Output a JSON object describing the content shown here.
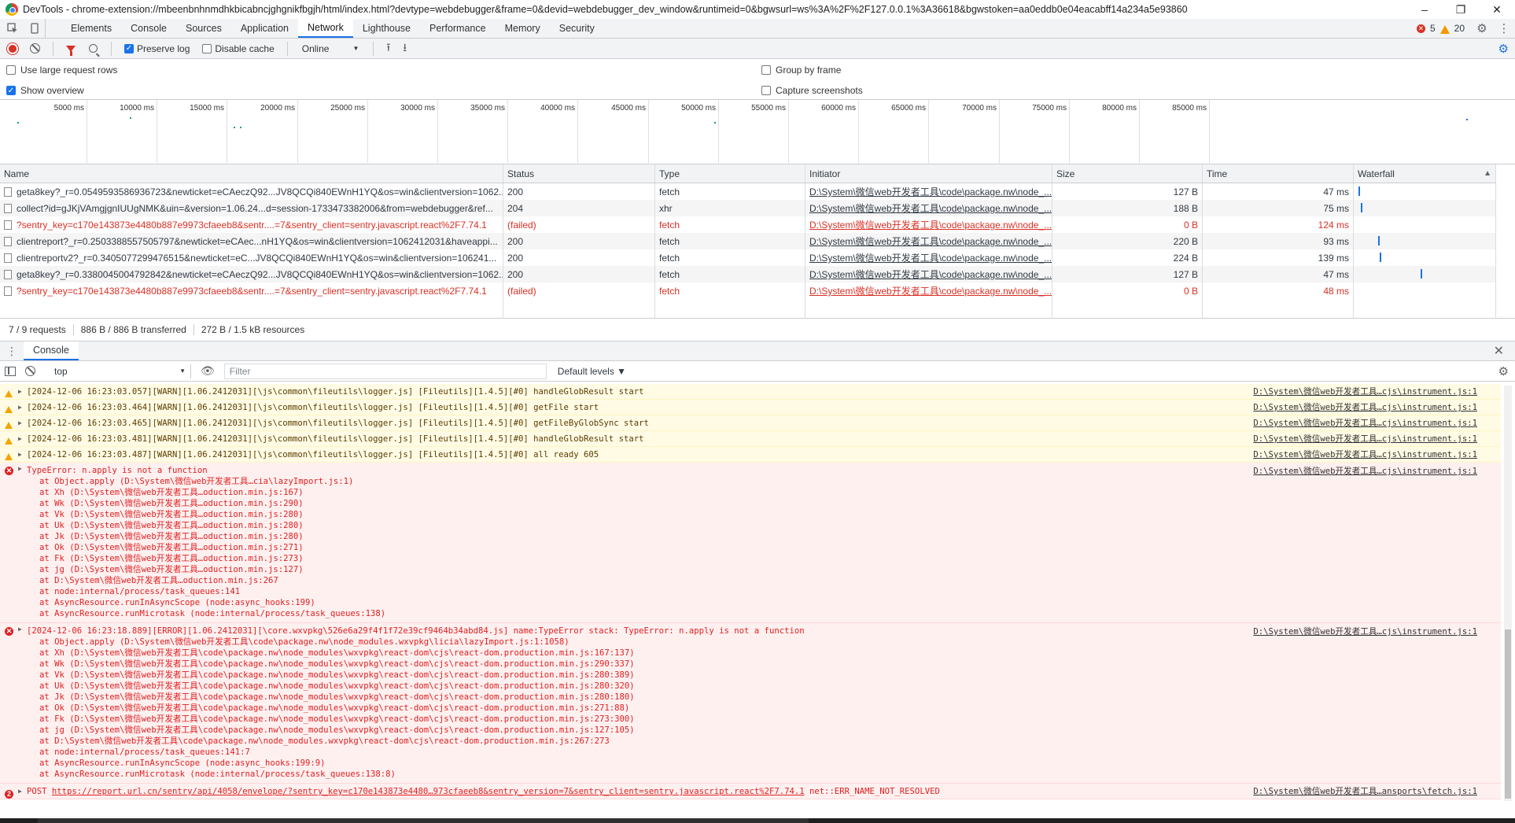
{
  "window": {
    "title": "DevTools - chrome-extension://mbeenbnhnmdhkbicabncjghgnikfbgjh/html/index.html?devtype=webdebugger&frame=0&devid=webdebugger_dev_window&runtimeid=0&bgwsurl=ws%3A%2F%2F127.0.0.1%3A36618&bgwstoken=aa0eddb0e04eacabff14a234a5e93860",
    "minimize": "–",
    "restore": "❐",
    "close": "✕"
  },
  "tabs": [
    "Elements",
    "Console",
    "Sources",
    "Application",
    "Network",
    "Lighthouse",
    "Performance",
    "Memory",
    "Security"
  ],
  "active_tab": "Network",
  "counts": {
    "errors": "5",
    "warnings": "20"
  },
  "toolbar": {
    "preserve_log": "Preserve log",
    "disable_cache": "Disable cache",
    "throttle": "Online",
    "throttle_arrow": "▼",
    "upload_icon": "⭱",
    "download_icon": "⭳"
  },
  "options": {
    "large_rows": "Use large request rows",
    "show_overview": "Show overview",
    "group_by_frame": "Group by frame",
    "capture_screenshots": "Capture screenshots"
  },
  "overview_ticks": [
    "5000 ms",
    "10000 ms",
    "15000 ms",
    "20000 ms",
    "25000 ms",
    "30000 ms",
    "35000 ms",
    "40000 ms",
    "45000 ms",
    "50000 ms",
    "55000 ms",
    "60000 ms",
    "65000 ms",
    "70000 ms",
    "75000 ms",
    "80000 ms",
    "85000 ms"
  ],
  "net_columns": [
    "Name",
    "Status",
    "Type",
    "Initiator",
    "Size",
    "Time",
    "Waterfall"
  ],
  "net_rows": [
    {
      "name": "geta8key?_r=0.0549593586936723&newticket=eCAeczQ92...JV8QCQi840EWnH1YQ&os=win&clientversion=1062...",
      "status": "200",
      "type": "fetch",
      "initiator": "D:\\System\\微信web开发者工具\\code\\package.nw\\node_...",
      "size": "127 B",
      "time": "47 ms",
      "failed": false,
      "wf": 0.01
    },
    {
      "name": "collect?id=gJKjVAmgjgnIUUgNMK&uin=&version=1.06.24...d=session-1733473382006&from=webdebugger&ref...",
      "status": "204",
      "type": "xhr",
      "initiator": "D:\\System\\微信web开发者工具\\code\\package.nw\\node_...",
      "size": "188 B",
      "time": "75 ms",
      "failed": false,
      "wf": 0.03
    },
    {
      "name": "?sentry_key=c170e143873e4480b887e9973cfaeeb8&sentr....=7&sentry_client=sentry.javascript.react%2F7.74.1",
      "status": "(failed)",
      "type": "fetch",
      "initiator": "D:\\System\\微信web开发者工具\\code\\package.nw\\node_...",
      "size": "0 B",
      "time": "124 ms",
      "failed": true,
      "wf": null
    },
    {
      "name": "clientreport?_r=0.2503388557505797&newticket=eCAec...nH1YQ&os=win&clientversion=1062412031&haveappi...",
      "status": "200",
      "type": "fetch",
      "initiator": "D:\\System\\微信web开发者工具\\code\\package.nw\\node_...",
      "size": "220 B",
      "time": "93 ms",
      "failed": false,
      "wf": 0.18
    },
    {
      "name": "clientreportv2?_r=0.3405077299476515&newticket=eC...JV8QCQi840EWnH1YQ&os=win&clientversion=106241...",
      "status": "200",
      "type": "fetch",
      "initiator": "D:\\System\\微信web开发者工具\\code\\package.nw\\node_...",
      "size": "224 B",
      "time": "139 ms",
      "failed": false,
      "wf": 0.19
    },
    {
      "name": "geta8key?_r=0.3380045004792842&newticket=eCAeczQ92...JV8QCQi840EWnH1YQ&os=win&clientversion=1062...",
      "status": "200",
      "type": "fetch",
      "initiator": "D:\\System\\微信web开发者工具\\code\\package.nw\\node_...",
      "size": "127 B",
      "time": "47 ms",
      "failed": false,
      "wf": 0.54
    },
    {
      "name": "?sentry_key=c170e143873e4480b887e9973cfaeeb8&sentr....=7&sentry_client=sentry.javascript.react%2F7.74.1",
      "status": "(failed)",
      "type": "fetch",
      "initiator": "D:\\System\\微信web开发者工具\\code\\package.nw\\node_...",
      "size": "0 B",
      "time": "48 ms",
      "failed": true,
      "wf": null
    }
  ],
  "net_footer": {
    "requests": "7 / 9 requests",
    "transferred": "886 B / 886 B transferred",
    "resources": "272 B / 1.5 kB resources"
  },
  "drawer": {
    "tab": "Console",
    "context": "top",
    "filter_placeholder": "Filter",
    "levels": "Default levels ▼"
  },
  "console": {
    "warns": [
      {
        "text": "[2024-12-06 16:23:03.057][WARN][1.06.2412031][\\js\\common\\fileutils\\logger.js] [Fileutils][1.4.5][#0] handleGlobResult start",
        "src": "D:\\System\\微信web开发者工具…cjs\\instrument.js:1"
      },
      {
        "text": "[2024-12-06 16:23:03.464][WARN][1.06.2412031][\\js\\common\\fileutils\\logger.js] [Fileutils][1.4.5][#0] getFile start",
        "src": "D:\\System\\微信web开发者工具…cjs\\instrument.js:1"
      },
      {
        "text": "[2024-12-06 16:23:03.465][WARN][1.06.2412031][\\js\\common\\fileutils\\logger.js] [Fileutils][1.4.5][#0] getFileByGlobSync start",
        "src": "D:\\System\\微信web开发者工具…cjs\\instrument.js:1"
      },
      {
        "text": "[2024-12-06 16:23:03.481][WARN][1.06.2412031][\\js\\common\\fileutils\\logger.js] [Fileutils][1.4.5][#0] handleGlobResult start",
        "src": "D:\\System\\微信web开发者工具…cjs\\instrument.js:1"
      },
      {
        "text": "[2024-12-06 16:23:03.487][WARN][1.06.2412031][\\js\\common\\fileutils\\logger.js] [Fileutils][1.4.5][#0] all ready 605",
        "src": "D:\\System\\微信web开发者工具…cjs\\instrument.js:1"
      }
    ],
    "error1": {
      "head": "TypeError: n.apply is not a function",
      "src": "D:\\System\\微信web开发者工具…cjs\\instrument.js:1",
      "stack": [
        "at Object.apply (D:\\System\\微信web开发者工具…cia\\lazyImport.js:1)",
        "at Xh (D:\\System\\微信web开发者工具…oduction.min.js:167)",
        "at Wk (D:\\System\\微信web开发者工具…oduction.min.js:290)",
        "at Vk (D:\\System\\微信web开发者工具…oduction.min.js:280)",
        "at Uk (D:\\System\\微信web开发者工具…oduction.min.js:280)",
        "at Jk (D:\\System\\微信web开发者工具…oduction.min.js:280)",
        "at Ok (D:\\System\\微信web开发者工具…oduction.min.js:271)",
        "at Fk (D:\\System\\微信web开发者工具…oduction.min.js:273)",
        "at jg (D:\\System\\微信web开发者工具…oduction.min.js:127)",
        "at D:\\System\\微信web开发者工具…oduction.min.js:267",
        "at node:internal/process/task_queues:141",
        "at AsyncResource.runInAsyncScope (node:async_hooks:199)",
        "at AsyncResource.runMicrotask (node:internal/process/task_queues:138)"
      ]
    },
    "error2": {
      "head": "[2024-12-06 16:23:18.889][ERROR][1.06.2412031][\\core.wxvpkg\\526e6a29f4f1f72e39cf9464b34abd84.js] name:TypeError stack: TypeError: n.apply is not a function",
      "src": "D:\\System\\微信web开发者工具…cjs\\instrument.js:1",
      "stack": [
        "at Object.apply (D:\\System\\微信web开发者工具\\code\\package.nw\\node_modules.wxvpkg\\licia\\lazyImport.js:1:1058)",
        "at Xh (D:\\System\\微信web开发者工具\\code\\package.nw\\node_modules\\wxvpkg\\react-dom\\cjs\\react-dom.production.min.js:167:137)",
        "at Wk (D:\\System\\微信web开发者工具\\code\\package.nw\\node_modules\\wxvpkg\\react-dom\\cjs\\react-dom.production.min.js:290:337)",
        "at Vk (D:\\System\\微信web开发者工具\\code\\package.nw\\node_modules\\wxvpkg\\react-dom\\cjs\\react-dom.production.min.js:280:389)",
        "at Uk (D:\\System\\微信web开发者工具\\code\\package.nw\\node_modules\\wxvpkg\\react-dom\\cjs\\react-dom.production.min.js:280:320)",
        "at Jk (D:\\System\\微信web开发者工具\\code\\package.nw\\node_modules\\wxvpkg\\react-dom\\cjs\\react-dom.production.min.js:280:180)",
        "at Ok (D:\\System\\微信web开发者工具\\code\\package.nw\\node_modules\\wxvpkg\\react-dom\\cjs\\react-dom.production.min.js:271:88)",
        "at Fk (D:\\System\\微信web开发者工具\\code\\package.nw\\node_modules\\wxvpkg\\react-dom\\cjs\\react-dom.production.min.js:273:300)",
        "at jg (D:\\System\\微信web开发者工具\\code\\package.nw\\node_modules\\wxvpkg\\react-dom\\cjs\\react-dom.production.min.js:127:105)",
        "at D:\\System\\微信web开发者工具\\code\\package.nw\\node_modules.wxvpkg\\react-dom\\cjs\\react-dom.production.min.js:267:273",
        "at node:internal/process/task_queues:141:7",
        "at AsyncResource.runInAsyncScope (node:async_hooks:199:9)",
        "at AsyncResource.runMicrotask (node:internal/process/task_queues:138:8)"
      ]
    },
    "post": {
      "count": "2",
      "method": "POST",
      "url": "https://report.url.cn/sentry/api/4058/envelope/?sentry_key=c170e143873e4480…973cfaeeb8&sentry_version=7&sentry_client=sentry.javascript.react%2F7.74.1",
      "error": "net::ERR_NAME_NOT_RESOLVED",
      "src": "D:\\System\\微信web开发者工具…ansports\\fetch.js:1"
    },
    "prompt": "›"
  }
}
